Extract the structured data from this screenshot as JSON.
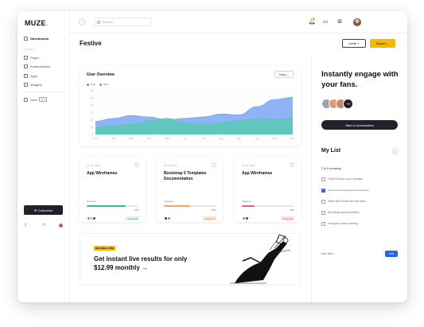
{
  "brand": {
    "name": "MUZE",
    "dot": "."
  },
  "sidebar": {
    "section_label": "PAGES",
    "items": [
      {
        "label": "Dashboards",
        "chevron": "⌄"
      },
      {
        "label": "Pages",
        "chevron": "⌄"
      },
      {
        "label": "Authentication",
        "chevron": "⌄"
      },
      {
        "label": "Apps",
        "chevron": "⌄"
      },
      {
        "label": "Widgets",
        "chevron": ""
      },
      {
        "label": "Docs",
        "badge": "v1.0"
      }
    ],
    "customize_label": "⚙ Customize",
    "footer_icons": [
      "chart-icon",
      "gear-icon",
      "avatar"
    ]
  },
  "topbar": {
    "search_placeholder": "Search...",
    "icons": [
      "bell-icon",
      "chat-icon",
      "grid-icon",
      "user-avatar"
    ]
  },
  "page": {
    "title": "Festive",
    "invite_label": "Invite +",
    "export_label": "Export ⌄"
  },
  "overview": {
    "title": "User Overview",
    "range_label": "Today ⌄",
    "legend": [
      "2020",
      "2021"
    ]
  },
  "chart_data": {
    "type": "area",
    "categories": [
      "Jan",
      "Feb",
      "Mar",
      "Apr",
      "May",
      "Jun",
      "Jul",
      "Aug",
      "Sep",
      "Oct",
      "Nov",
      "Dec"
    ],
    "yticks": [
      "0",
      "10",
      "20",
      "30",
      "40",
      "50",
      "60"
    ],
    "ylim": [
      0,
      60
    ],
    "series": [
      {
        "name": "2020",
        "color": "#7aa7f5",
        "values": [
          18,
          22,
          26,
          24,
          20,
          22,
          24,
          28,
          27,
          38,
          48,
          51
        ]
      },
      {
        "name": "2021",
        "color": "#5cc8b7",
        "values": [
          9,
          12,
          14,
          19,
          22,
          16,
          14,
          16,
          19,
          22,
          21,
          22
        ]
      }
    ]
  },
  "projects": [
    {
      "date": "15 Jun 2021",
      "title": "App Wireframes",
      "progress_label": "Progress",
      "progress": 75,
      "pct": "75%",
      "badge": "4 days left",
      "bar_color": "#35b999",
      "badge_bg": "#d8f6ea",
      "badge_fg": "#2c9f7d"
    },
    {
      "date": "16 Jun 2021",
      "title": "Bootstrap 5 Templates Documentation",
      "progress_label": "Progress",
      "progress": 50,
      "pct": "50%",
      "badge": "5 days left",
      "bar_color": "#f4a262",
      "badge_bg": "#fde6d4",
      "badge_fg": "#d9782f"
    },
    {
      "date": "22 Jun 2021",
      "title": "App Wireframes",
      "progress_label": "Progress",
      "progress": 25,
      "pct": "25%",
      "badge": "2 days left",
      "bar_color": "#ef5b7a",
      "badge_bg": "#fde0e6",
      "badge_fg": "#d9435f"
    }
  ],
  "promo": {
    "tag": "BECOME A PRO",
    "text": "Get instant live results for only $12.99 monthly →"
  },
  "right": {
    "headline": "Instantly engage with your fans.",
    "more_count": "+9",
    "convo_label": "Start a conversation",
    "list_title": "My List",
    "remaining": "2 of 5 remaining",
    "todos": [
      {
        "label": "Finish Sketch color updates",
        "done": false
      },
      {
        "label": "New onboarding workflow/assets",
        "done": true
      },
      {
        "label": "Meet with Daniel and the team",
        "done": false
      },
      {
        "label": "Bootstrap documentation",
        "done": false
      },
      {
        "label": "Arrange a team meeting",
        "done": false
      }
    ],
    "new_item_label": "New item...",
    "add_label": "Add"
  }
}
